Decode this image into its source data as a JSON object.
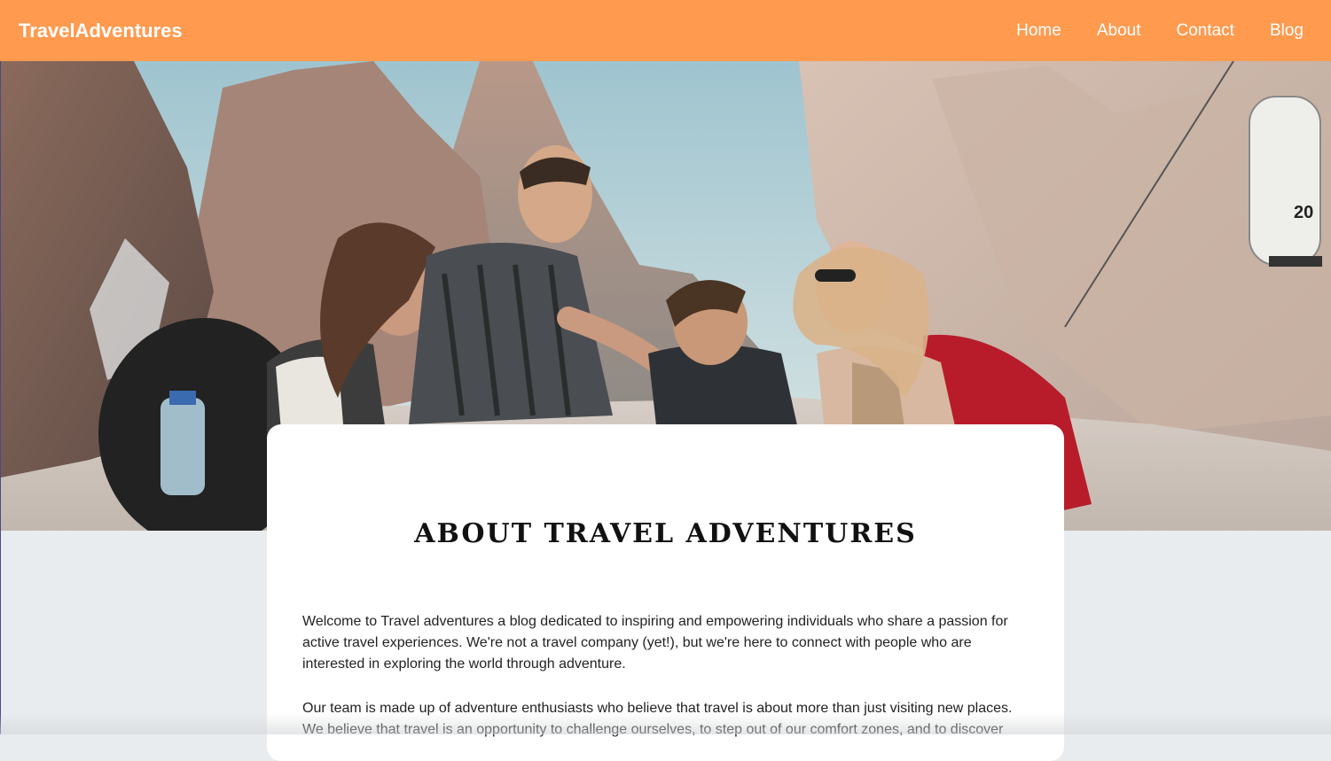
{
  "navbar": {
    "brand": "TravelAdventures",
    "links": [
      "Home",
      "About",
      "Contact",
      "Blog"
    ]
  },
  "hero": {
    "image_icon": "hero-photo-hikers-mountains",
    "gondola_number": "20"
  },
  "about": {
    "title": "ABOUT TRAVEL ADVENTURES",
    "paragraph_1": "Welcome to Travel adventures a blog dedicated to inspiring and empowering individuals who share a passion for active travel experiences. We're not a travel company (yet!), but we're here to connect with people who are interested in exploring the world through adventure.",
    "paragraph_2": "Our team is made up of adventure enthusiasts who believe that travel is about more than just visiting new places. We believe that travel is an opportunity to challenge ourselves, to step out of our comfort zones, and to discover"
  },
  "colors": {
    "navbar_bg": "#ff9a4f",
    "page_bg": "#e9ecef",
    "card_bg": "#ffffff"
  }
}
